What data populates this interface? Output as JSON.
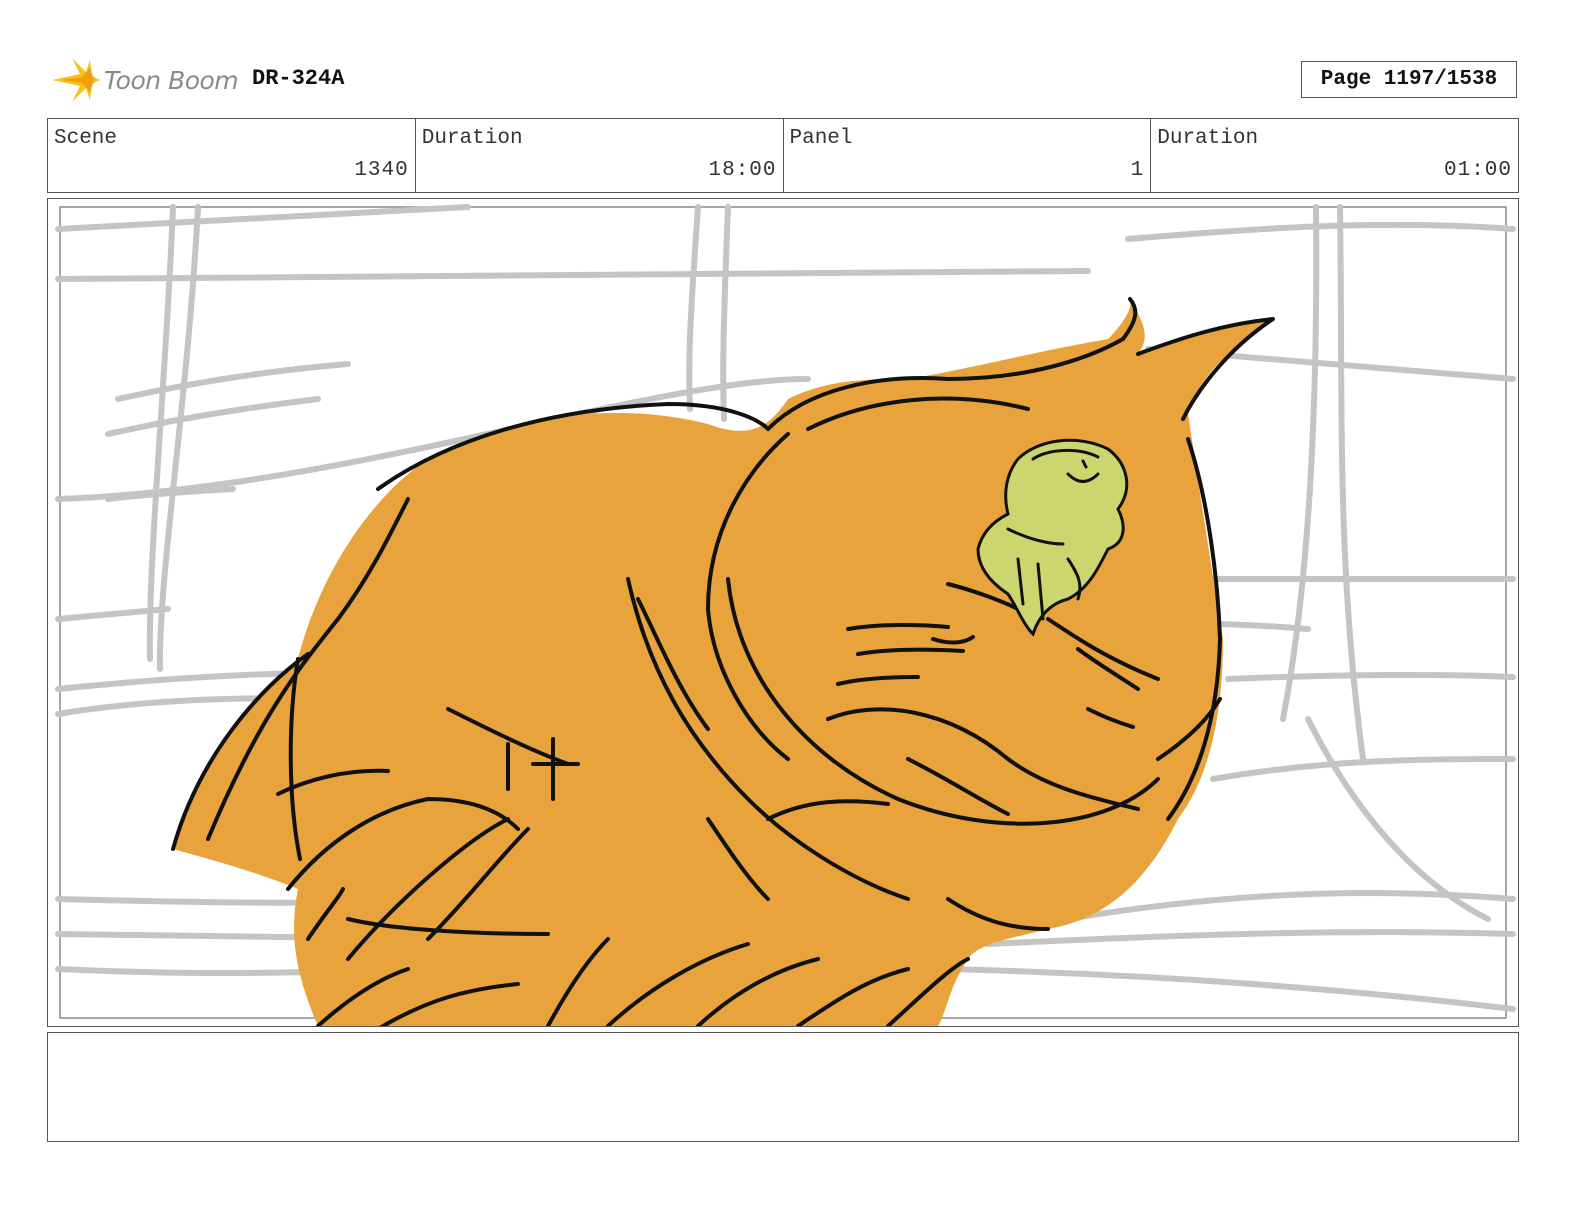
{
  "header": {
    "logo_text": "Toon Boom",
    "doc_code": "DR-324A",
    "page_label": "Page 1197/1538"
  },
  "info": {
    "scene_label": "Scene",
    "scene_value": "1340",
    "duration_label": "Duration",
    "duration_value": "18:00",
    "panel_label": "Panel",
    "panel_value": "1",
    "panel_duration_label": "Duration",
    "panel_duration_value": "01:00"
  },
  "notes": {
    "text": ""
  },
  "colors": {
    "creature_fill": "#E8A33D",
    "rider_fill": "#CBD66E",
    "sketch_gray": "#c4c4c4",
    "logo_yellow": "#F5C518"
  }
}
